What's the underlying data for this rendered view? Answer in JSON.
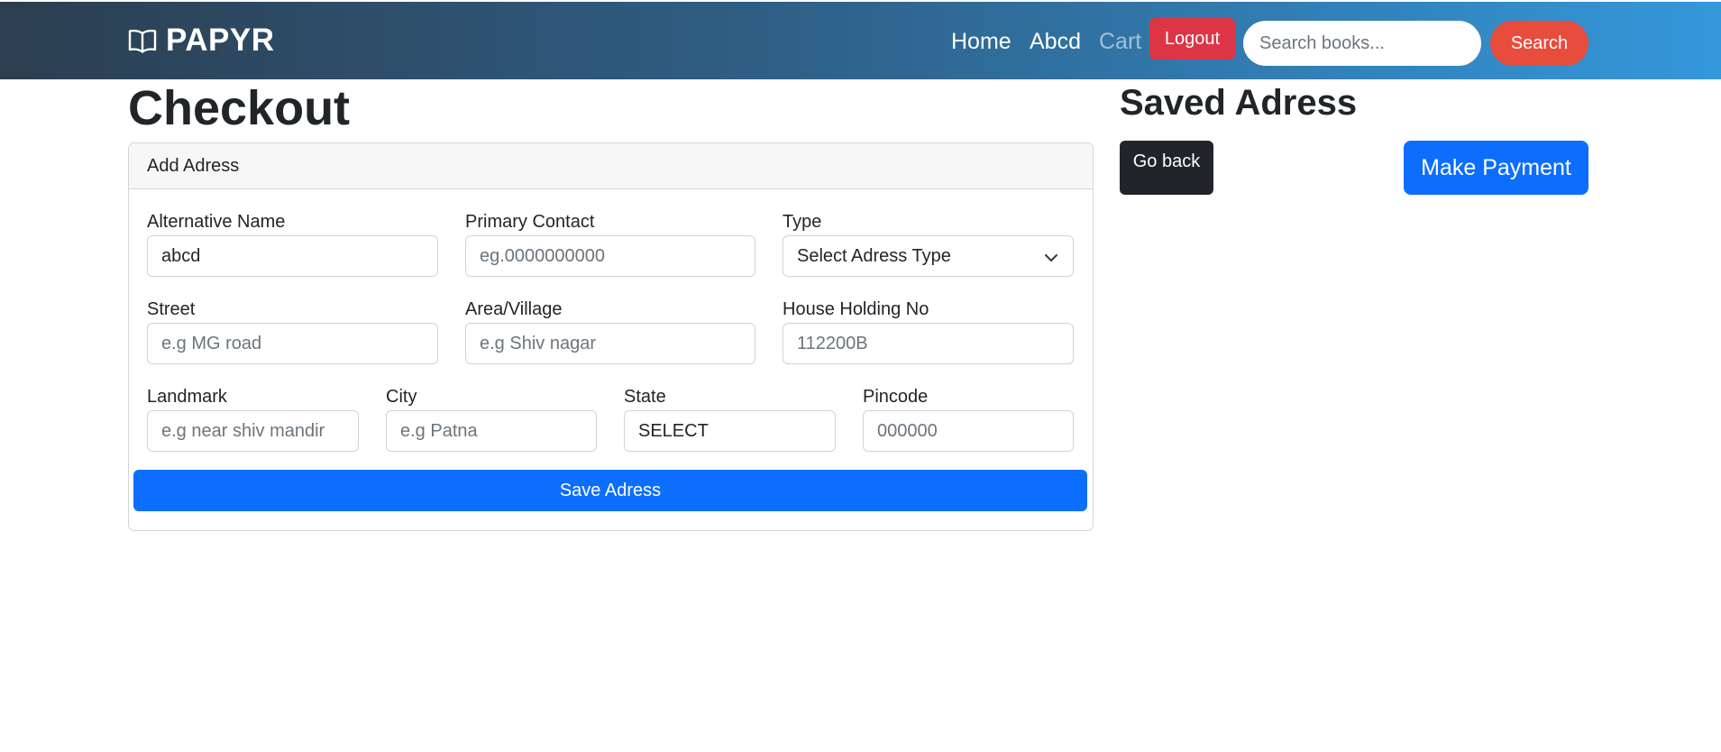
{
  "navbar": {
    "brand": "PAPYR",
    "brand_icon": "open-book-icon",
    "links": {
      "home": "Home",
      "user": "Abcd",
      "cart": "Cart"
    },
    "logout_label": "Logout",
    "search_placeholder": "Search books...",
    "search_label": "Search",
    "colors": {
      "logout": "#dc3545",
      "search": "#e74c3c"
    }
  },
  "page": {
    "title": "Checkout"
  },
  "card": {
    "header": "Add Adress",
    "fields": {
      "alt_name": {
        "label": "Alternative Name",
        "value": "abcd"
      },
      "primary_contact": {
        "label": "Primary Contact",
        "placeholder": "eg.0000000000"
      },
      "type": {
        "label": "Type",
        "value": "Select Adress Type"
      },
      "street": {
        "label": "Street",
        "placeholder": "e.g MG road"
      },
      "area": {
        "label": "Area/Village",
        "placeholder": "e.g Shiv nagar"
      },
      "house": {
        "label": "House Holding No",
        "placeholder": "112200B"
      },
      "landmark": {
        "label": "Landmark",
        "placeholder": "e.g near shiv mandir"
      },
      "city": {
        "label": "City",
        "placeholder": "e.g Patna"
      },
      "state": {
        "label": "State",
        "value": "SELECT"
      },
      "pincode": {
        "label": "Pincode",
        "placeholder": "000000"
      }
    },
    "save_label": "Save Adress"
  },
  "sidebar": {
    "title": "Saved Adress",
    "go_back_label": "Go back",
    "make_payment_label": "Make Payment"
  }
}
